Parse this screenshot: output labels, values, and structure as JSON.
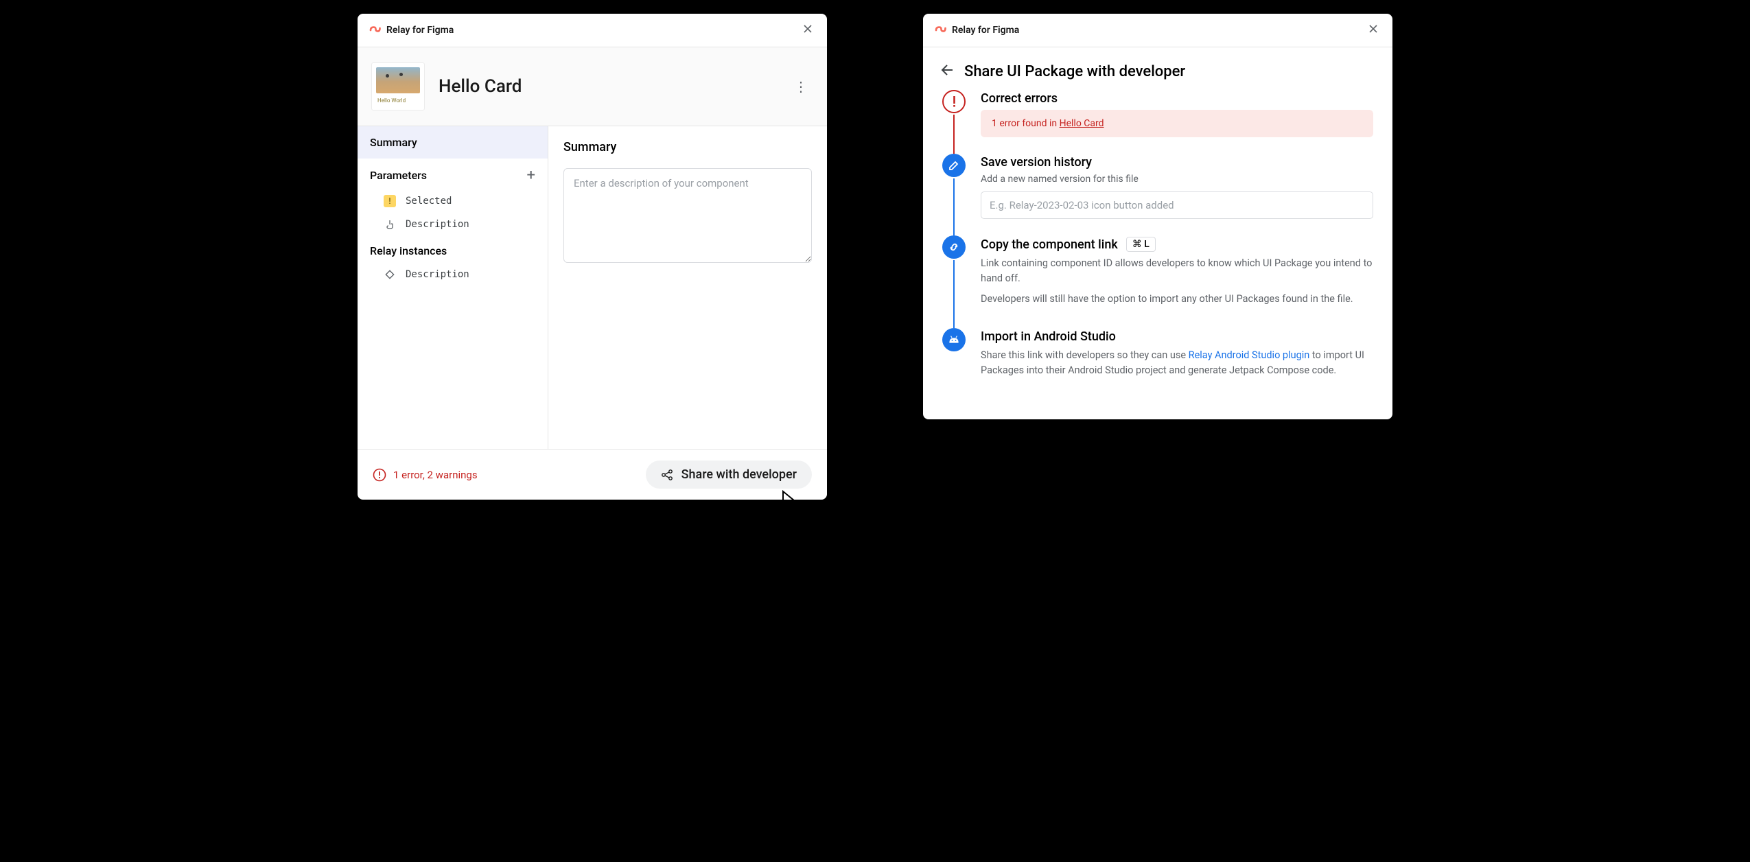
{
  "app_title": "Relay for Figma",
  "left": {
    "card_title": "Hello Card",
    "thumb_caption": "Hello World",
    "sidebar": {
      "summary_tab": "Summary",
      "parameters_label": "Parameters",
      "param_selected": "Selected",
      "param_description": "Description",
      "relay_instances_label": "Relay instances",
      "instance_description": "Description"
    },
    "main": {
      "heading": "Summary",
      "description_placeholder": "Enter a description of your component"
    },
    "footer": {
      "error_text": "1 error, 2 warnings",
      "share_label": "Share with developer"
    }
  },
  "right": {
    "page_title": "Share UI Package with developer",
    "steps": {
      "correct_errors": {
        "title": "Correct errors",
        "banner_prefix": "1 error found in ",
        "banner_link": "Hello Card"
      },
      "save_version": {
        "title": "Save version history",
        "sub": "Add a new named version for this file",
        "placeholder": "E.g. Relay-2023-02-03 icon button added"
      },
      "copy_link": {
        "title": "Copy the component link",
        "shortcut": "⌘ L",
        "para1": "Link containing component ID allows developers to know which UI Package you intend to hand off.",
        "para2": "Developers will still have the option to import any other UI Packages found in the file."
      },
      "import": {
        "title": "Import in Android Studio",
        "para_prefix": "Share this link with developers so they can use ",
        "link_text": "Relay Android Studio plugin",
        "para_suffix": " to import UI Packages into their Android Studio project and generate Jetpack Compose code."
      }
    }
  }
}
